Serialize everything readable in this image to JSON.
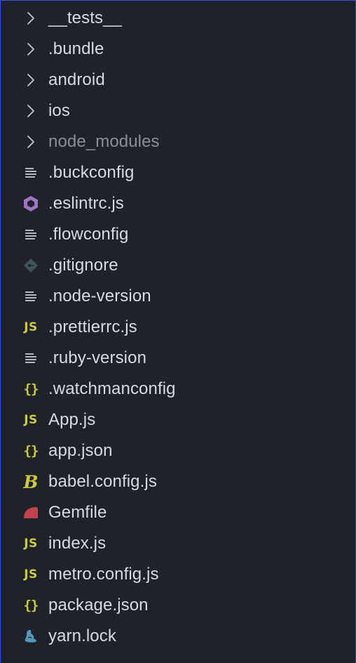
{
  "explorer": {
    "items": [
      {
        "label": "__tests__",
        "kind": "folder",
        "icon": "chevron-right-icon"
      },
      {
        "label": ".bundle",
        "kind": "folder",
        "icon": "chevron-right-icon"
      },
      {
        "label": "android",
        "kind": "folder",
        "icon": "chevron-right-icon"
      },
      {
        "label": "ios",
        "kind": "folder",
        "icon": "chevron-right-icon"
      },
      {
        "label": "node_modules",
        "kind": "folder",
        "icon": "chevron-right-icon",
        "dimmed": true
      },
      {
        "label": ".buckconfig",
        "kind": "file",
        "icon": "text-file-icon"
      },
      {
        "label": ".eslintrc.js",
        "kind": "file",
        "icon": "eslint-icon"
      },
      {
        "label": ".flowconfig",
        "kind": "file",
        "icon": "text-file-icon"
      },
      {
        "label": ".gitignore",
        "kind": "file",
        "icon": "git-icon"
      },
      {
        "label": ".node-version",
        "kind": "file",
        "icon": "text-file-icon"
      },
      {
        "label": ".prettierrc.js",
        "kind": "file",
        "icon": "javascript-icon"
      },
      {
        "label": ".ruby-version",
        "kind": "file",
        "icon": "text-file-icon"
      },
      {
        "label": ".watchmanconfig",
        "kind": "file",
        "icon": "json-icon"
      },
      {
        "label": "App.js",
        "kind": "file",
        "icon": "javascript-icon"
      },
      {
        "label": "app.json",
        "kind": "file",
        "icon": "json-icon"
      },
      {
        "label": "babel.config.js",
        "kind": "file",
        "icon": "babel-icon"
      },
      {
        "label": "Gemfile",
        "kind": "file",
        "icon": "ruby-gem-icon"
      },
      {
        "label": "index.js",
        "kind": "file",
        "icon": "javascript-icon"
      },
      {
        "label": "metro.config.js",
        "kind": "file",
        "icon": "javascript-icon"
      },
      {
        "label": "package.json",
        "kind": "file",
        "icon": "json-icon"
      },
      {
        "label": "yarn.lock",
        "kind": "file",
        "icon": "yarn-icon"
      }
    ]
  },
  "icon_text": {
    "javascript": "JS",
    "json": "{}",
    "babel": "B"
  },
  "colors": {
    "background": "#1f2228",
    "text": "#d7dae0",
    "dimmed_text": "#8a8f98",
    "focus_border": "#3b4cff",
    "js_yellow": "#cbcb41",
    "eslint_purple": "#a074c4",
    "git_gray": "#41535b",
    "ruby_red": "#c3424e",
    "yarn_blue": "#519aba"
  }
}
